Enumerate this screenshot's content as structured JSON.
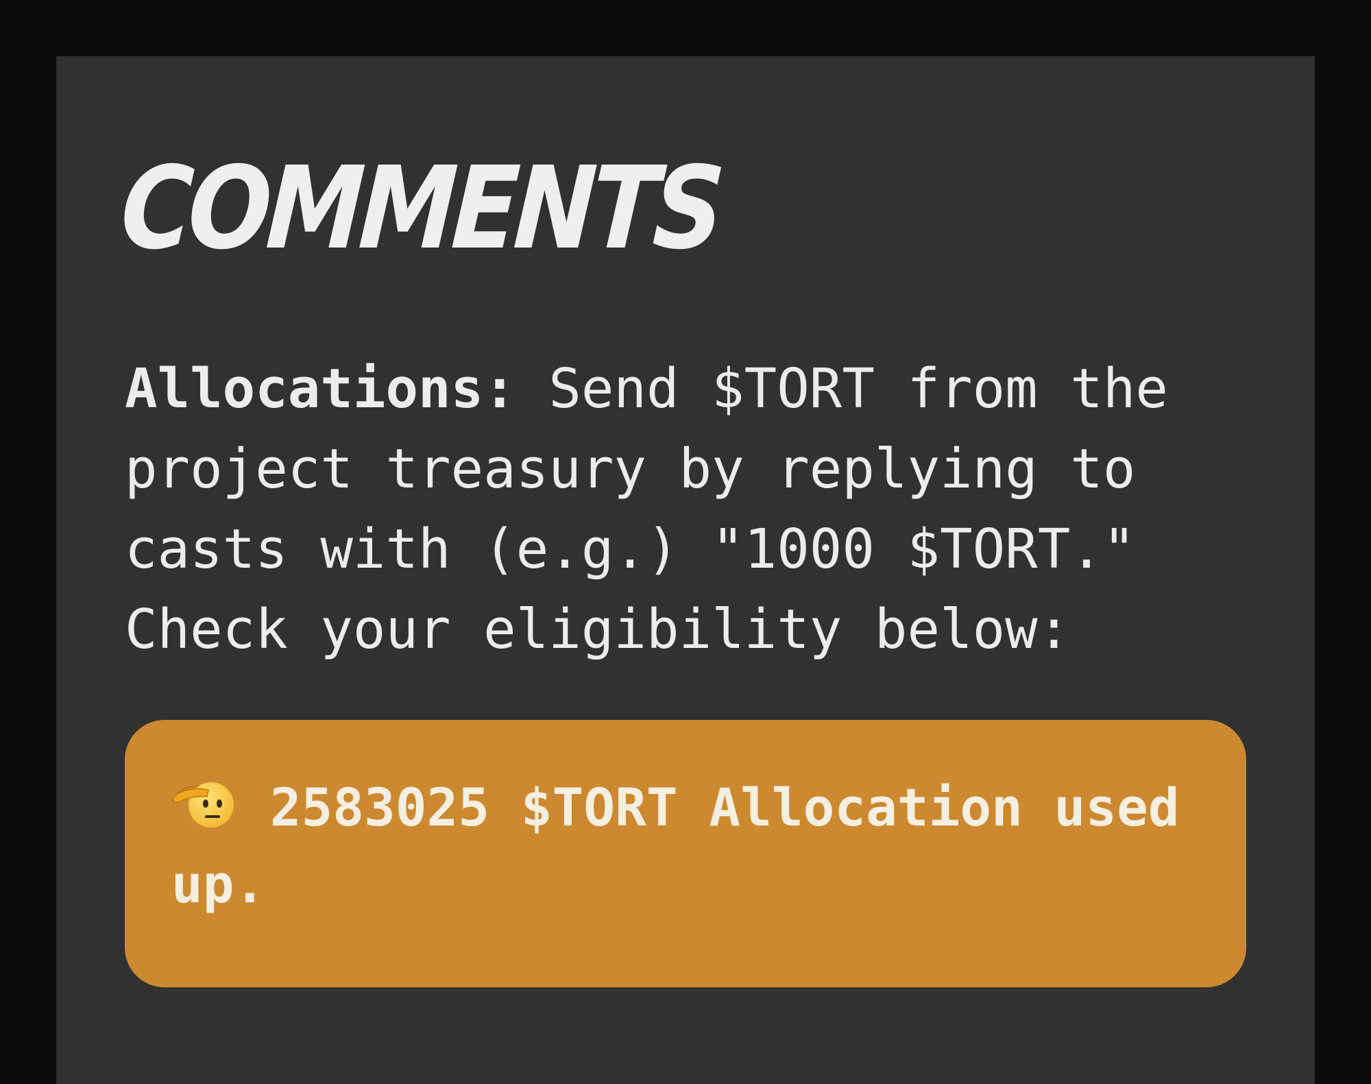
{
  "comments": {
    "title": "Comments",
    "description": {
      "label": "Allocations:",
      "text": "Send $TORT from the project treasury by replying to casts with (e.g.) \"1000 $TORT.\" Check your eligibility below:"
    },
    "notice": {
      "icon": "saluting-face-emoji",
      "message": "2583025 $TORT Allocation used up.",
      "background_color": "#cd892f"
    }
  },
  "colors": {
    "page_background": "#0b0b0b",
    "panel_background": "#313131",
    "text": "#ececec"
  }
}
